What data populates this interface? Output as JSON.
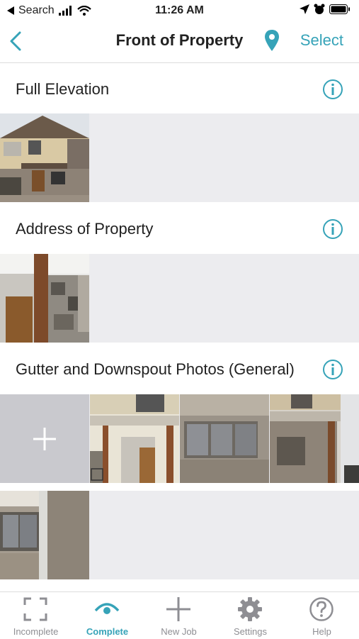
{
  "status_bar": {
    "back_app": "Search",
    "time": "11:26 AM"
  },
  "nav": {
    "title": "Front of Property",
    "select_label": "Select"
  },
  "sections": [
    {
      "title": "Full Elevation"
    },
    {
      "title": "Address of Property"
    },
    {
      "title": "Gutter and Downspout Photos (General)"
    }
  ],
  "tabs": [
    {
      "label": "Incomplete",
      "icon": "incomplete-icon"
    },
    {
      "label": "Complete",
      "icon": "eye-icon"
    },
    {
      "label": "New Job",
      "icon": "plus-icon"
    },
    {
      "label": "Settings",
      "icon": "gear-icon"
    },
    {
      "label": "Help",
      "icon": "help-icon"
    }
  ],
  "colors": {
    "accent": "#36a3b8",
    "inactive": "#8e8e93",
    "row_bg": "#ececef"
  }
}
